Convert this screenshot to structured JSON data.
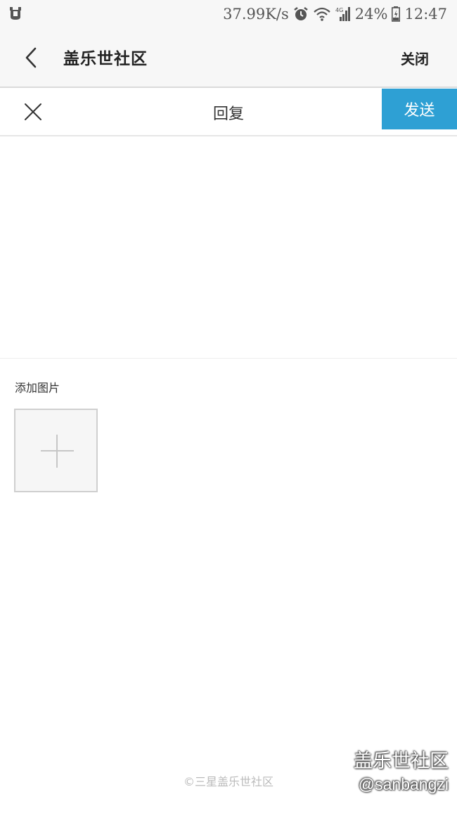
{
  "status_bar": {
    "network_speed": "37.99K/s",
    "network_type": "4G",
    "battery": "24%",
    "time": "12:47",
    "icons": [
      "notification-icon",
      "alarm-icon",
      "wifi-icon",
      "signal-icon",
      "battery-icon"
    ]
  },
  "header": {
    "title": "盖乐世社区",
    "close_label": "关闭"
  },
  "toolbar": {
    "title": "回复",
    "send_label": "发送"
  },
  "reply": {
    "value": ""
  },
  "attachments": {
    "label": "添加图片"
  },
  "footer": {
    "copyright": "©三星盖乐世社区"
  },
  "watermark": {
    "title": "盖乐世社区",
    "handle": "@sanbangzi"
  },
  "colors": {
    "accent": "#2ea0d4",
    "header_bg": "#f7f7f7",
    "divider": "#dadada"
  }
}
